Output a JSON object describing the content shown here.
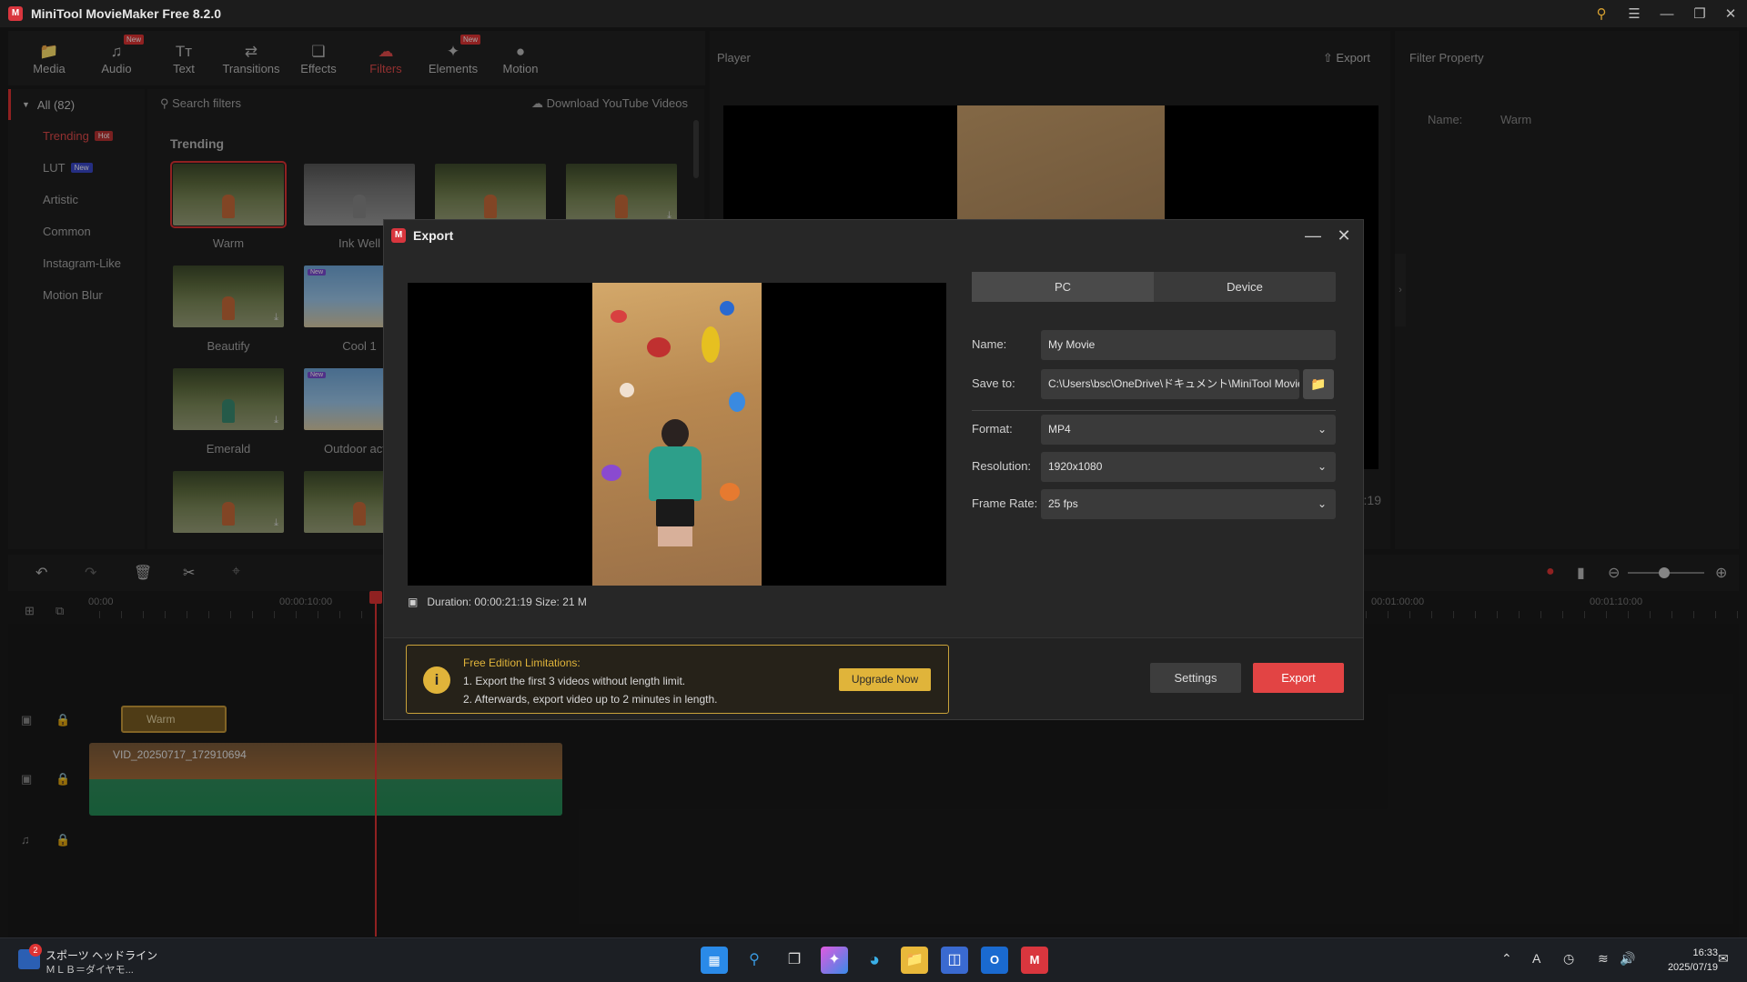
{
  "app": {
    "title": "MiniTool MovieMaker Free 8.2.0"
  },
  "toolbar": {
    "items": [
      {
        "label": "Media",
        "icon": "folder-icon"
      },
      {
        "label": "Audio",
        "icon": "music-note-icon",
        "badge": "New"
      },
      {
        "label": "Text",
        "icon": "text-icon"
      },
      {
        "label": "Transitions",
        "icon": "swap-arrows-icon"
      },
      {
        "label": "Effects",
        "icon": "effects-icon"
      },
      {
        "label": "Filters",
        "icon": "filter-cloud-icon",
        "active": true
      },
      {
        "label": "Elements",
        "icon": "elements-icon",
        "badge": "New"
      },
      {
        "label": "Motion",
        "icon": "motion-icon"
      }
    ]
  },
  "categories": {
    "all_label": "All (82)",
    "items": [
      {
        "label": "Trending",
        "badge": "Hot",
        "active": true
      },
      {
        "label": "LUT",
        "badge": "New"
      },
      {
        "label": "Artistic"
      },
      {
        "label": "Common"
      },
      {
        "label": "Instagram-Like"
      },
      {
        "label": "Motion Blur"
      }
    ]
  },
  "filters": {
    "search_placeholder": "Search filters",
    "download_link": "Download YouTube Videos",
    "section_title": "Trending",
    "thumbs": [
      {
        "label": "Warm"
      },
      {
        "label": "Ink Well"
      },
      {
        "label": ""
      },
      {
        "label": ""
      },
      {
        "label": "Beautify"
      },
      {
        "label": "Cool 1"
      },
      {
        "label": "Emerald"
      },
      {
        "label": "Outdoor actio"
      },
      {
        "label": ""
      },
      {
        "label": ""
      }
    ]
  },
  "player": {
    "title": "Player",
    "export_label": "Export",
    "time_fragment": ":19"
  },
  "property": {
    "title": "Filter Property",
    "name_label": "Name:",
    "name_value": "Warm"
  },
  "timeline": {
    "ruler": [
      "00:00",
      "00:00:10:00",
      "00:01:00:00",
      "00:01:10:00"
    ],
    "filter_clip": "Warm",
    "video_clip": "VID_20250717_172910694"
  },
  "dialog": {
    "title": "Export",
    "tabs": [
      "PC",
      "Device"
    ],
    "name_label": "Name:",
    "name_value": "My Movie",
    "save_label": "Save to:",
    "save_value": "C:\\Users\\bsc\\OneDrive\\ドキュメント\\MiniTool MovieM",
    "format_label": "Format:",
    "format_value": "MP4",
    "resolution_label": "Resolution:",
    "resolution_value": "1920x1080",
    "framerate_label": "Frame Rate:",
    "framerate_value": "25 fps",
    "duration_label": "Duration:",
    "duration_value": "00:00:21:19",
    "size_label": "Size:",
    "size_value": "21 M",
    "limit_title": "Free Edition Limitations:",
    "limit_line1": "1. Export the first 3 videos without length limit.",
    "limit_line2": "2. Afterwards, export video up to 2 minutes in length.",
    "upgrade_label": "Upgrade Now",
    "settings_label": "Settings",
    "export_label": "Export"
  },
  "taskbar": {
    "news_title": "スポーツ ヘッドライン",
    "news_sub": "ＭＬＢ＝ダイヤモ...",
    "news_badge": "2",
    "time": "16:33",
    "date": "2025/07/19",
    "ime": "A"
  }
}
